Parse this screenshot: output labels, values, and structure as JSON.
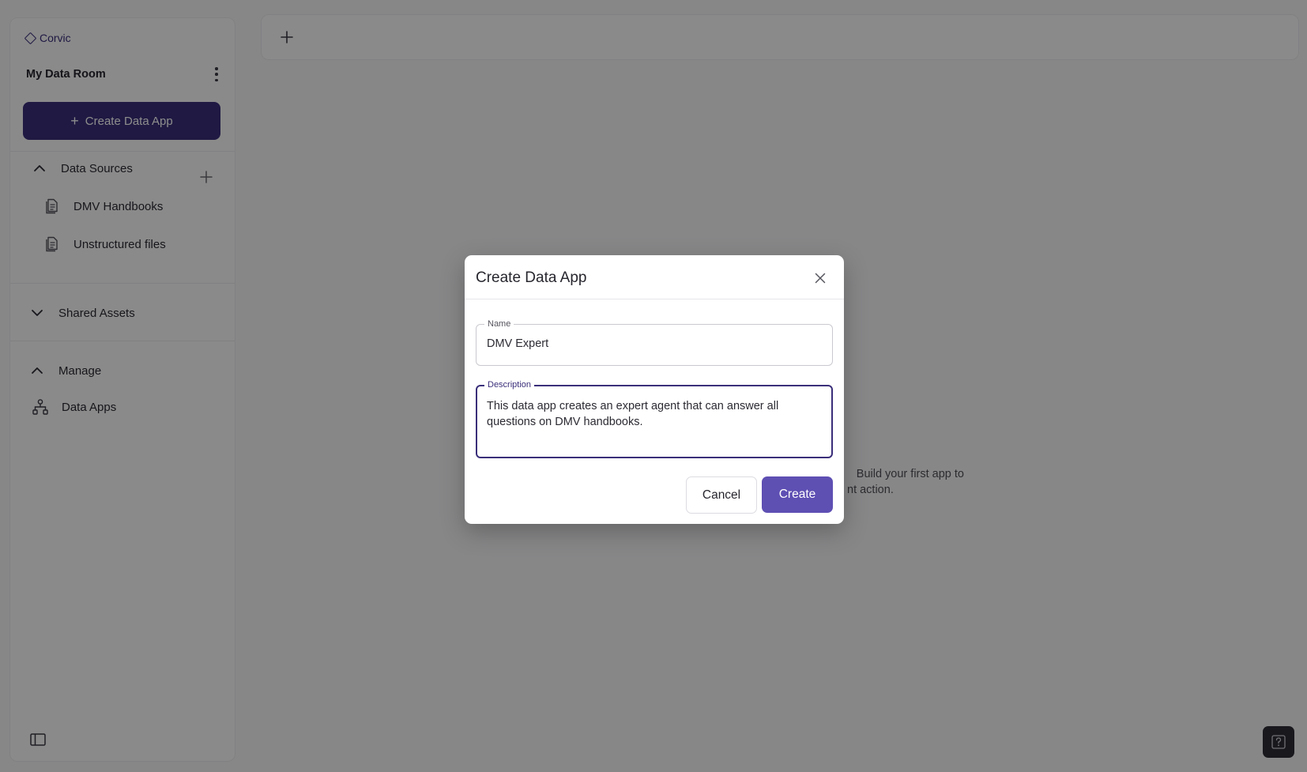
{
  "sidebar": {
    "brand": "Corvic",
    "room_name": "My Data Room",
    "create_button": "Create Data App",
    "sections": {
      "data_sources": {
        "label": "Data Sources",
        "items": [
          {
            "label": "DMV Handbooks",
            "icon": "document-icon"
          },
          {
            "label": "Unstructured files",
            "icon": "document-icon"
          }
        ]
      },
      "shared_assets": {
        "label": "Shared Assets"
      },
      "manage": {
        "label": "Manage",
        "items": [
          {
            "label": "Data Apps",
            "icon": "hierarchy-icon"
          }
        ]
      }
    }
  },
  "main": {
    "empty_text_line1": "Build your first app to",
    "empty_text_line2": "nt action."
  },
  "modal": {
    "title": "Create Data App",
    "name_label": "Name",
    "name_value": "DMV Expert",
    "description_label": "Description",
    "description_value": "This data app creates an expert agent that can answer all questions on DMV handbooks.",
    "cancel_label": "Cancel",
    "create_label": "Create"
  },
  "colors": {
    "brand": "#3a2f7a",
    "create_button": "#5e4fb3"
  }
}
